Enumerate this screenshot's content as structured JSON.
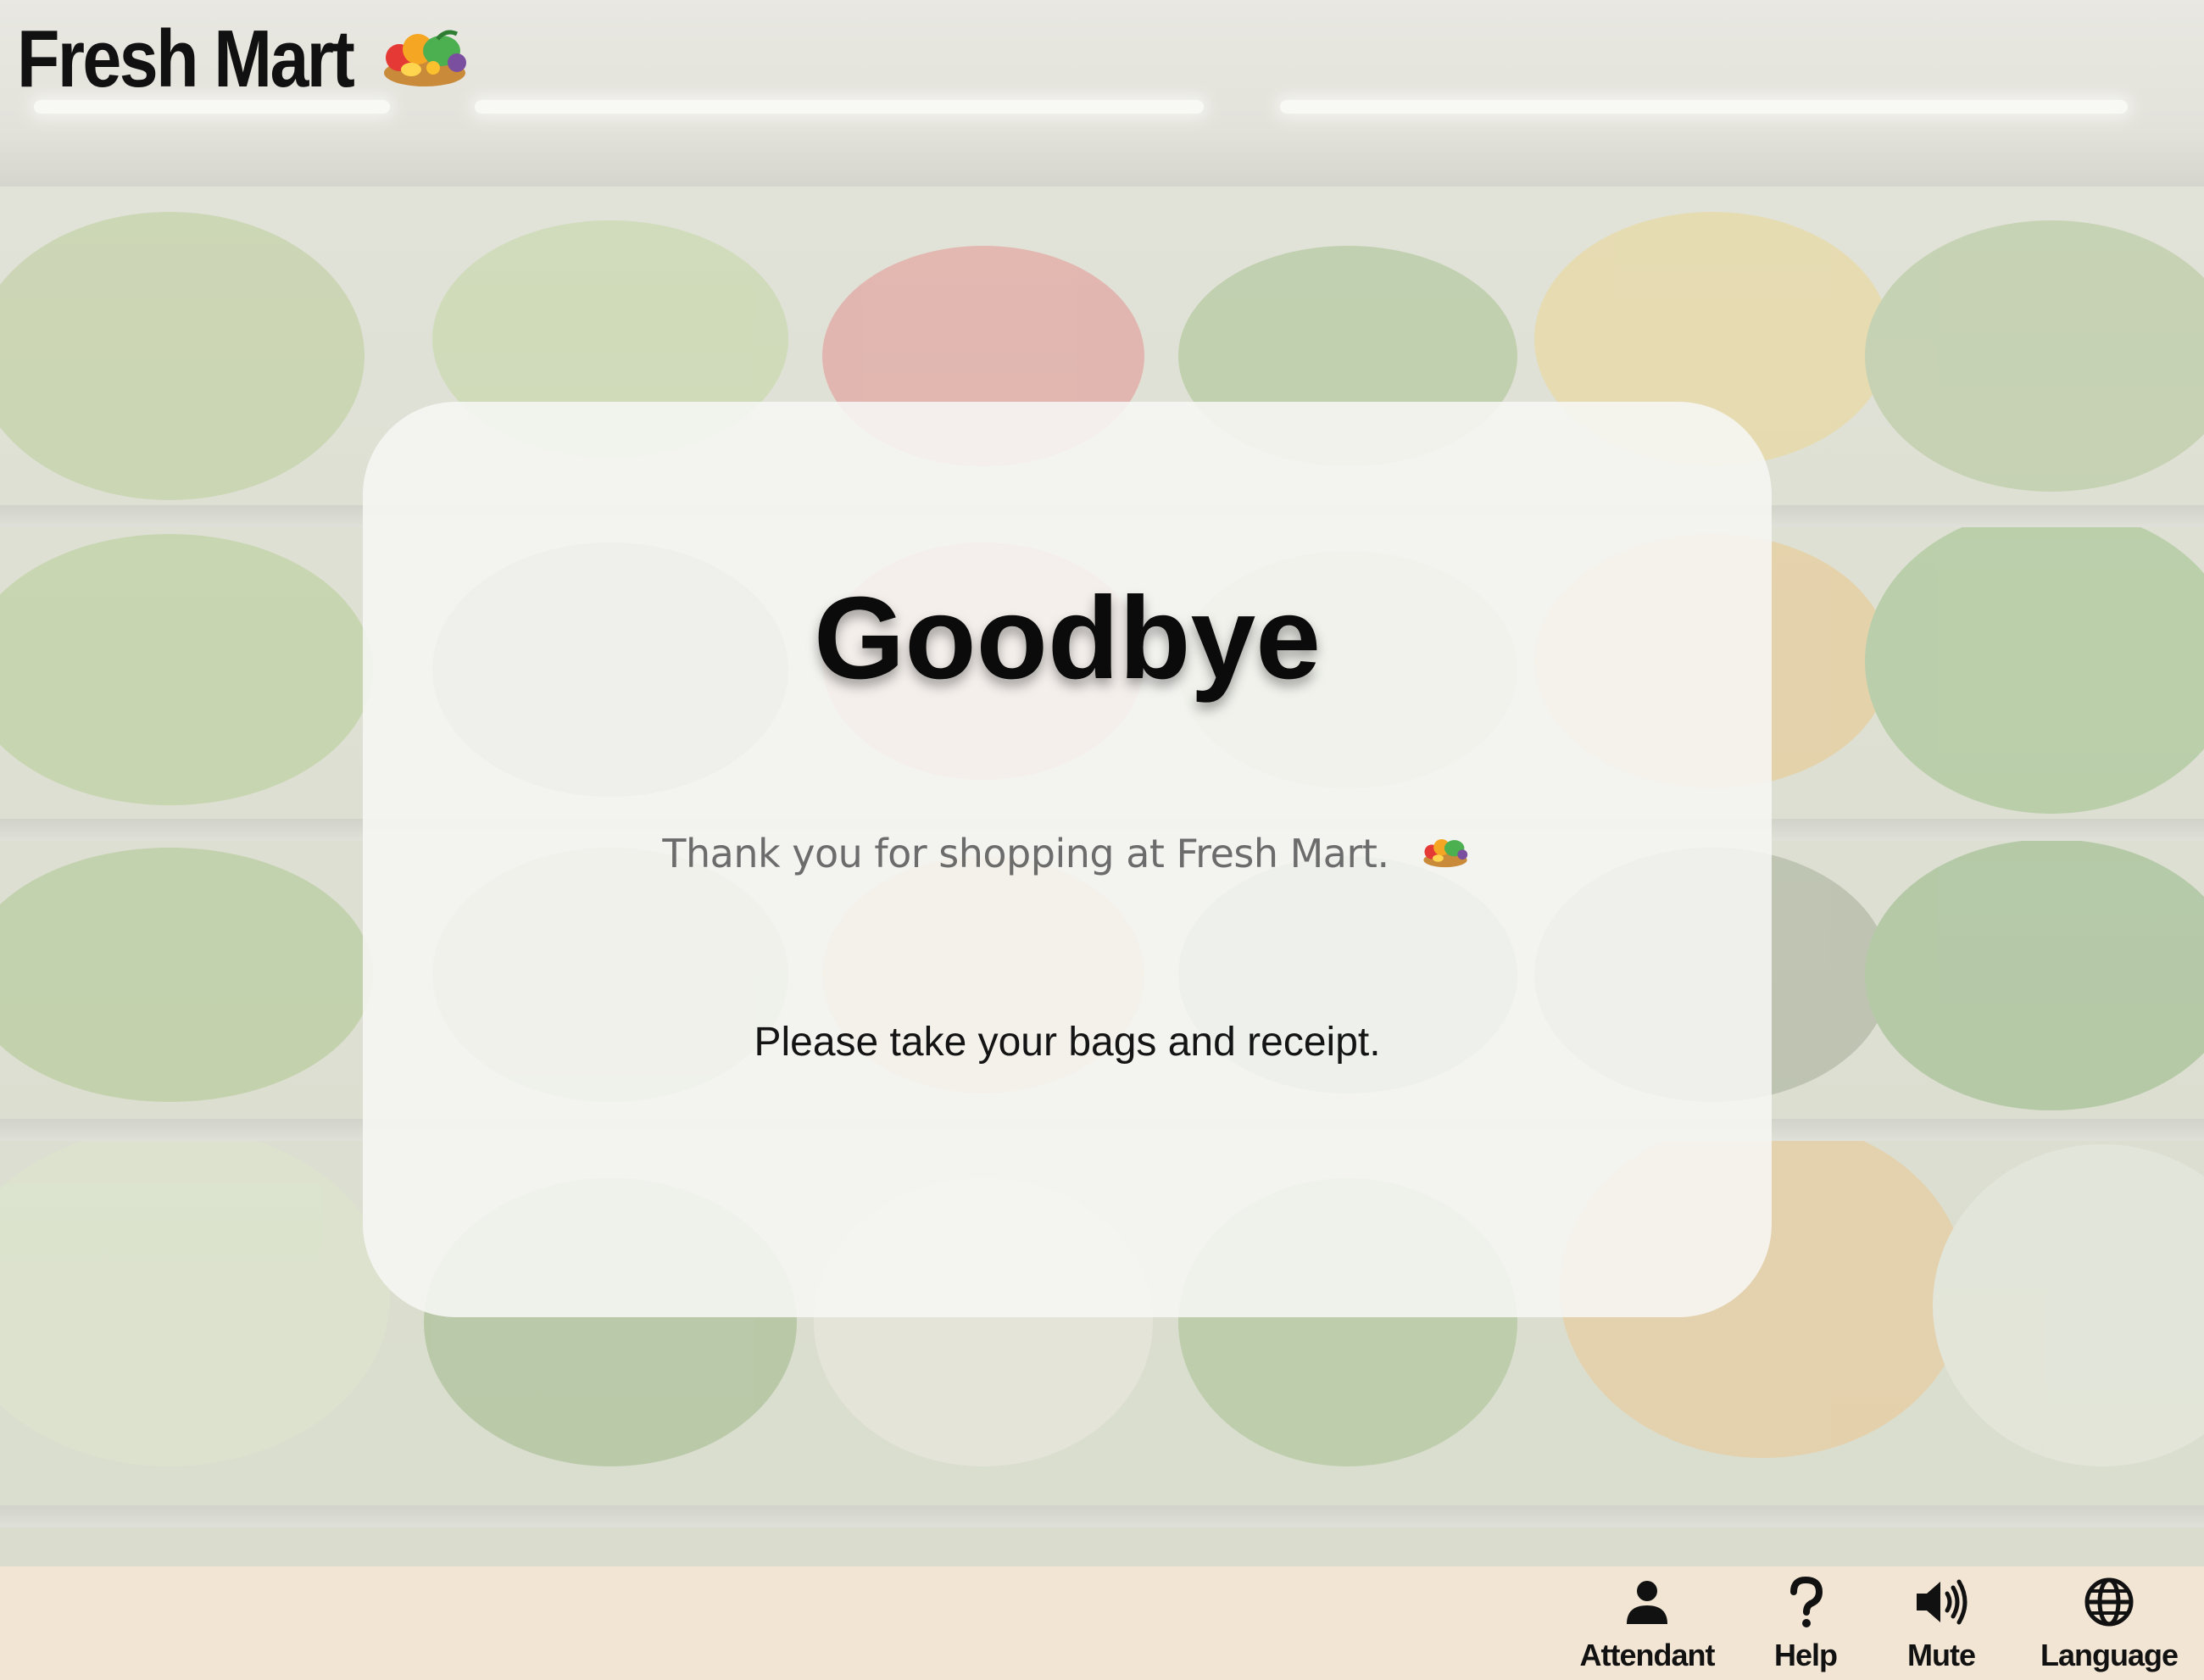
{
  "header": {
    "brand_name": "Fresh Mart",
    "brand_icon": "produce-basket-icon"
  },
  "card": {
    "title": "Goodbye",
    "thanks": "Thank you for shopping at Fresh Mart.",
    "thanks_icon": "produce-basket-icon",
    "instruction": "Please take your bags and receipt."
  },
  "bottom_bar": {
    "background": "#f3e5d4",
    "buttons": [
      {
        "label": "Attendant",
        "icon": "person-icon"
      },
      {
        "label": "Help",
        "icon": "question-icon"
      },
      {
        "label": "Mute",
        "icon": "speaker-icon"
      },
      {
        "label": "Language",
        "icon": "globe-icon"
      }
    ]
  },
  "colors": {
    "card_background": "#f6f6f4",
    "title_text": "#0b0b0b"
  }
}
